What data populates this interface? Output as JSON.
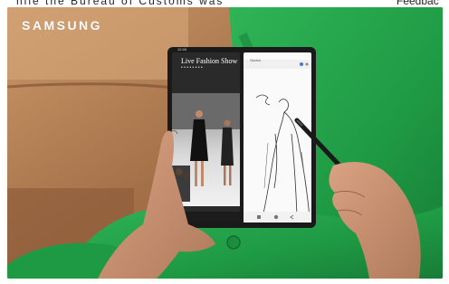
{
  "top_text": {
    "left": "hile the Bureau of Customs was",
    "right": "Feedbac"
  },
  "photo": {
    "brand": "SAMSUNG",
    "phone": {
      "status_time": "12:45",
      "video_title": "Live Fashion Show",
      "video_subtitle": "• • •  • •  • • •",
      "notes_app_label": "Sketch"
    }
  },
  "colors": {
    "sofa_brown": "#b07c56",
    "outfit_green": "#22a04a",
    "phone_black": "#1a1a1a",
    "skin": "#c99272"
  }
}
